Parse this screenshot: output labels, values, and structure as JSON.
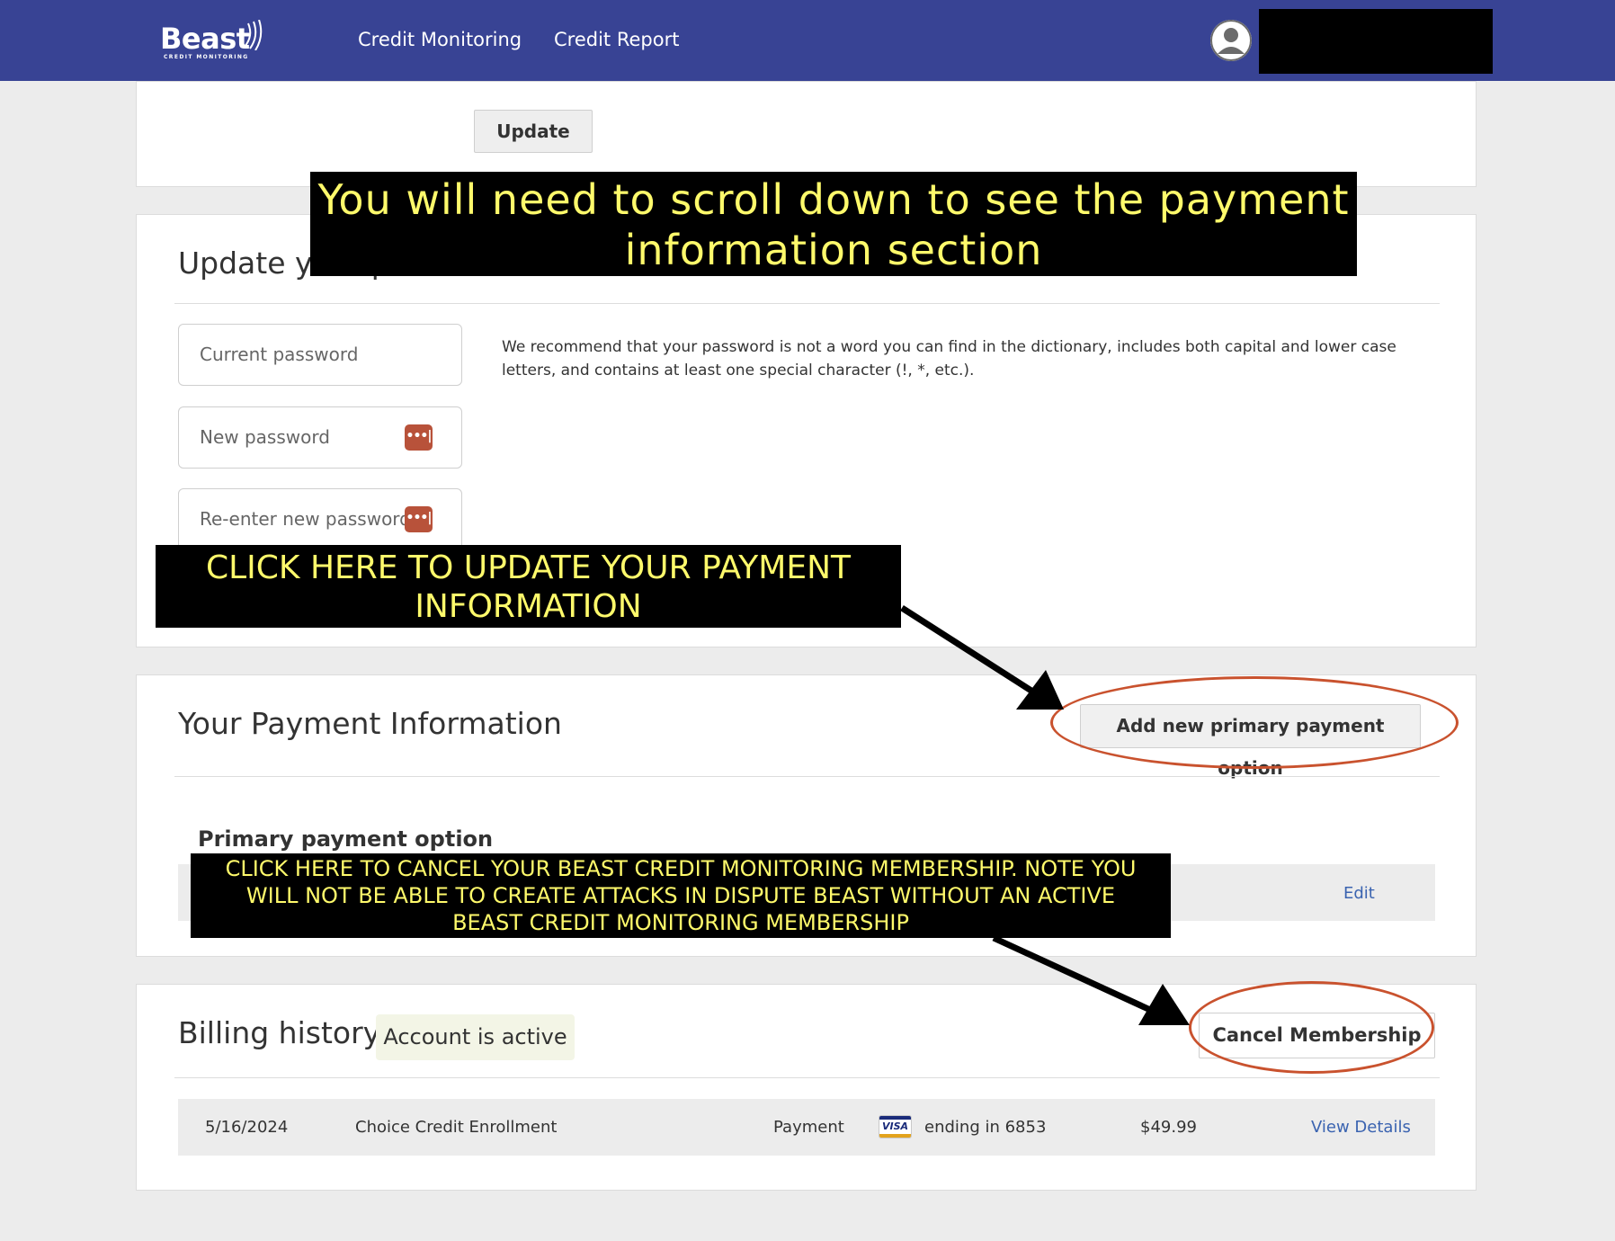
{
  "header": {
    "logo_text": "Beast",
    "logo_subtext": "CREDIT MONITORING",
    "nav": [
      "Credit Monitoring",
      "Credit Report"
    ],
    "avatar_icon": "user-avatar-icon"
  },
  "profile_card": {
    "update_button": "Update"
  },
  "password_card": {
    "title": "Update your password",
    "fields": {
      "current_placeholder": "Current password",
      "new_placeholder": "New password",
      "reenter_placeholder": "Re-enter new password"
    },
    "password_key_icon": "password-manager-icon",
    "recommendation": "We recommend that your password is not a word you can find in the dictionary, includes both capital and lower case letters, and contains at least one special character (!, *, etc.)."
  },
  "payment_card": {
    "title": "Your Payment Information",
    "add_button": "Add new primary payment option",
    "primary_label": "Primary payment option",
    "edit_link": "Edit"
  },
  "billing_card": {
    "title": "Billing history",
    "status": "Account is active",
    "cancel_button": "Cancel Membership",
    "rows": [
      {
        "date": "5/16/2024",
        "description": "Choice Credit Enrollment",
        "type": "Payment",
        "card_brand": "VISA",
        "card_text": "ending in 6853",
        "amount": "$49.99",
        "action": "View Details"
      }
    ]
  },
  "annotations": {
    "scroll_note_line1": "You will need to scroll down to see the payment",
    "scroll_note_line2": "information section",
    "update_payment_line1": "CLICK HERE TO UPDATE YOUR PAYMENT",
    "update_payment_line2": "INFORMATION",
    "cancel_line1": "CLICK HERE TO CANCEL YOUR BEAST CREDIT MONITORING MEMBERSHIP. NOTE YOU",
    "cancel_line2": "WILL NOT BE ABLE TO CREATE ATTACKS IN DISPUTE BEAST WITHOUT AN ACTIVE",
    "cancel_line3": "BEAST CREDIT MONITORING MEMBERSHIP"
  },
  "colors": {
    "header_bg": "#384394",
    "callout_bg": "#000000",
    "callout_text": "#fffa6b",
    "highlight_ellipse": "#c9522e",
    "link": "#3a63b0",
    "status_bg": "#f3f5e6"
  }
}
